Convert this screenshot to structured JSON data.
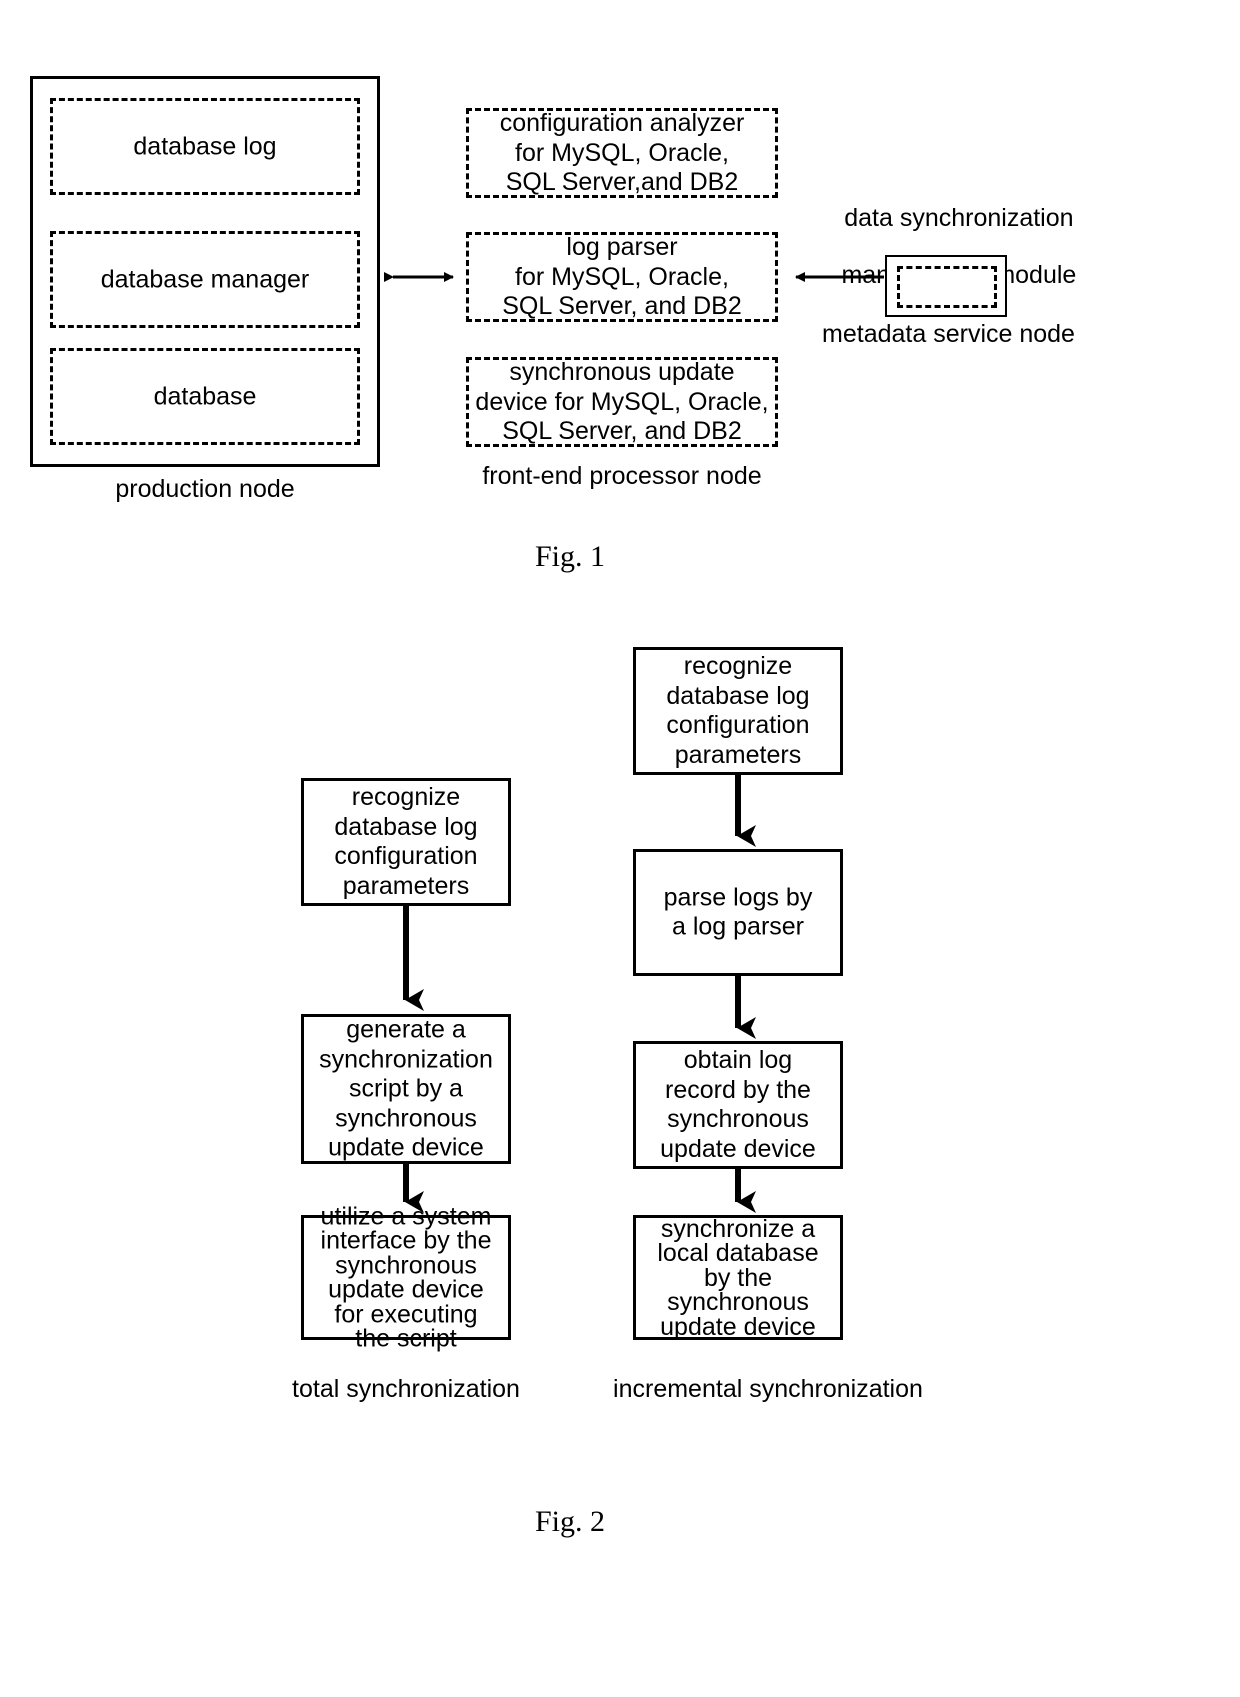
{
  "figures": [
    {
      "id": "fig1",
      "caption": "Fig. 1",
      "nodes": {
        "production_node": {
          "label": "production node",
          "items": [
            {
              "text": "database log"
            },
            {
              "text": "database manager"
            },
            {
              "text": "database"
            }
          ]
        },
        "front_end_processor_node": {
          "label": "front-end processor node",
          "items": [
            {
              "lines": [
                "configuration analyzer",
                "for  MySQL, Oracle,",
                "SQL Server,and DB2"
              ]
            },
            {
              "lines": [
                "log parser",
                "for  MySQL, Oracle,",
                "SQL Server, and DB2"
              ]
            },
            {
              "lines": [
                "synchronous update",
                "device for MySQL, Oracle,",
                "SQL Server, and DB2"
              ]
            }
          ]
        },
        "metadata_service_node": {
          "title_lines": [
            "data synchronization",
            "management module"
          ],
          "label": "metadata service node"
        }
      },
      "connections": [
        {
          "name": "production-to-frontend",
          "style": "double-headed"
        },
        {
          "name": "metadata-to-logparser",
          "style": "single-headed-left"
        }
      ]
    },
    {
      "id": "fig2",
      "caption": "Fig. 2",
      "flows": [
        {
          "name": "total-synchronization",
          "label": "total synchronization",
          "steps": [
            {
              "lines": [
                "recognize",
                "database log",
                "configuration",
                "parameters"
              ]
            },
            {
              "lines": [
                "generate a",
                "synchronization",
                "script by a",
                "synchronous",
                "update device"
              ]
            },
            {
              "lines": [
                "utilize a system",
                "interface by the",
                "synchronous",
                "update device",
                "for executing",
                "the script"
              ]
            }
          ]
        },
        {
          "name": "incremental-synchronization",
          "label": "incremental synchronization",
          "steps": [
            {
              "lines": [
                "recognize",
                "database log",
                "configuration",
                "parameters"
              ]
            },
            {
              "lines": [
                "parse logs by",
                "a log parser"
              ]
            },
            {
              "lines": [
                "obtain log",
                "record by the",
                "synchronous",
                "update device"
              ]
            },
            {
              "lines": [
                "synchronize a",
                "local database",
                "by the",
                "synchronous",
                "update device"
              ]
            }
          ]
        }
      ]
    }
  ],
  "colors": {
    "stroke": "#000000",
    "background": "#ffffff"
  }
}
